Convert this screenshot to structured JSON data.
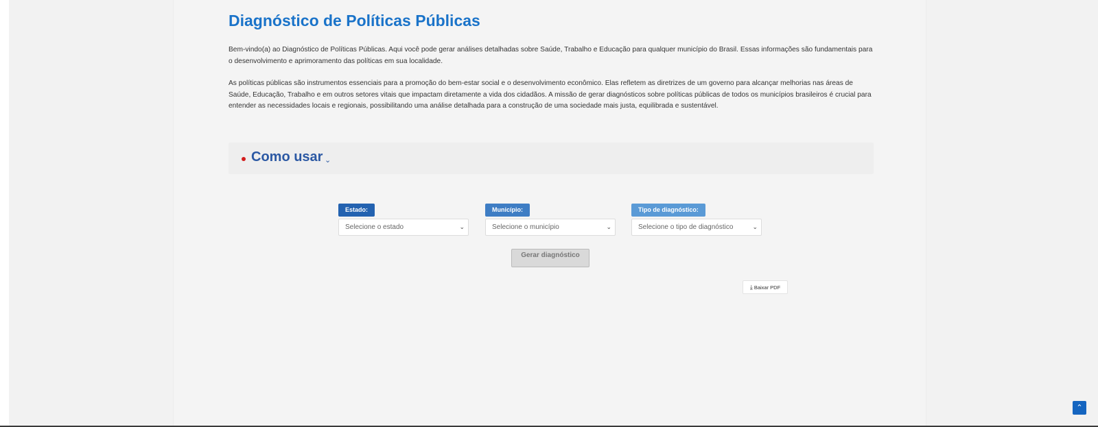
{
  "header": {
    "title": "Diagnóstico de Políticas Públicas"
  },
  "intro": {
    "paragraph1": "Bem-vindo(a) ao Diagnóstico de Políticas Públicas. Aqui você pode gerar análises detalhadas sobre Saúde, Trabalho e Educação para qualquer município do Brasil. Essas informações são fundamentais para o desenvolvimento e aprimoramento das políticas em sua localidade.",
    "paragraph2": "As políticas públicas são instrumentos essenciais para a promoção do bem-estar social e o desenvolvimento econômico. Elas refletem as diretrizes de um governo para alcançar melhorias nas áreas de Saúde, Educação, Trabalho e em outros setores vitais que impactam diretamente a vida dos cidadãos. A missão de gerar diagnósticos sobre políticas públicas de todos os municípios brasileiros é crucial para entender as necessidades locais e regionais, possibilitando uma análise detalhada para a construção de uma sociedade mais justa, equilibrada e sustentável."
  },
  "howto": {
    "label": "Como usar",
    "bullet_color": "#d31d1d",
    "chevron_icon": "chevron-down-icon"
  },
  "form": {
    "estado": {
      "label": "Estado:",
      "placeholder": "Selecione o estado"
    },
    "municipio": {
      "label": "Município:",
      "placeholder": "Selecione o município"
    },
    "tipo": {
      "label": "Tipo de diagnóstico:",
      "placeholder": "Selecione o tipo de diagnóstico"
    },
    "generate_button": "Gerar diagnóstico",
    "generate_enabled": false
  },
  "actions": {
    "download_pdf": "Baixar PDF",
    "download_icon": "download-icon"
  },
  "colors": {
    "title": "#1a73c9",
    "estado_tag": "#2362b0",
    "municipio_tag": "#3e7dc4",
    "tipo_tag": "#5a9ad6",
    "scroll_top": "#1565c0"
  }
}
